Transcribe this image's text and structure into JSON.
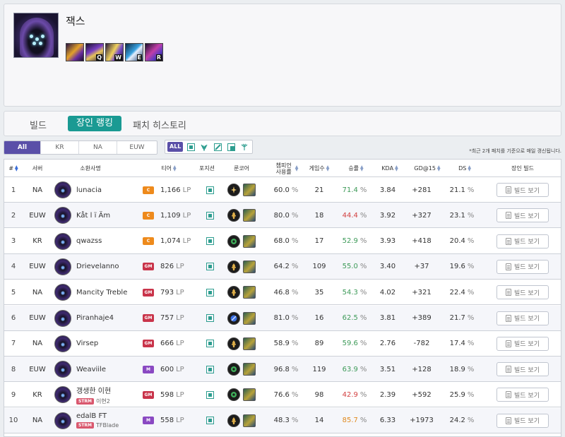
{
  "champion": {
    "name": "잭스",
    "skills": [
      {
        "key": "",
        "icon": "passive-icon"
      },
      {
        "key": "Q",
        "icon": "skill-q-icon"
      },
      {
        "key": "W",
        "icon": "skill-w-icon"
      },
      {
        "key": "E",
        "icon": "skill-e-icon"
      },
      {
        "key": "R",
        "icon": "skill-r-icon"
      }
    ]
  },
  "tabs": [
    {
      "label": "빌드",
      "active": false
    },
    {
      "label": "장인 랭킹",
      "active": true
    },
    {
      "label": "패치 히스토리",
      "active": false
    }
  ],
  "regions": [
    {
      "label": "All",
      "active": true
    },
    {
      "label": "KR",
      "active": false
    },
    {
      "label": "NA",
      "active": false
    },
    {
      "label": "EUW",
      "active": false
    }
  ],
  "positions": {
    "all_label": "ALL",
    "icons": [
      "top-lane-icon",
      "jungle-icon",
      "mid-lane-icon",
      "bottom-lane-icon",
      "support-icon"
    ]
  },
  "notice": "*최근 2개 패치를 기준으로 매일 갱신됩니다.",
  "columns": {
    "rank": "#",
    "server": "서버",
    "summoner": "소환사명",
    "tier": "티어",
    "position": "포지션",
    "rune": "룬코어",
    "pick_rate": "챔피언 사용률",
    "games": "게임수",
    "winrate": "승률",
    "kda": "KDA",
    "gd15": "GD@15",
    "ds": "DS",
    "build": "장인 빌드"
  },
  "lp_unit": "LP",
  "pct_unit": "%",
  "build_button_label": "빌드 보기",
  "colors": {
    "win_green": "#3d9a58",
    "win_red": "#d23f3f",
    "win_orange": "#e08a1e",
    "accent_teal": "#1a9a93",
    "accent_purple": "#5a4fa8"
  },
  "rows": [
    {
      "rank": "1",
      "server": "NA",
      "name": "lunacia",
      "sub": null,
      "tier": "C",
      "lp": "1,166",
      "rune": "electrocute-rune-icon",
      "pick": "60.0",
      "games": "21",
      "wr": "71.4",
      "wr_color": "green",
      "kda": "3.84",
      "gd": "+281",
      "ds": "21.1"
    },
    {
      "rank": "2",
      "server": "EUW",
      "name": "Kåt l ï Äm",
      "sub": null,
      "tier": "C",
      "lp": "1,109",
      "rune": "conqueror-rune-icon",
      "pick": "80.0",
      "games": "18",
      "wr": "44.4",
      "wr_color": "red",
      "kda": "3.92",
      "gd": "+327",
      "ds": "23.1"
    },
    {
      "rank": "3",
      "server": "KR",
      "name": "qwazss",
      "sub": null,
      "tier": "C",
      "lp": "1,074",
      "rune": "grasp-rune-icon",
      "pick": "68.0",
      "games": "17",
      "wr": "52.9",
      "wr_color": "green",
      "kda": "3.93",
      "gd": "+418",
      "ds": "20.4"
    },
    {
      "rank": "4",
      "server": "EUW",
      "name": "Drievelanno",
      "sub": null,
      "tier": "GM",
      "lp": "826",
      "rune": "conqueror-rune-icon",
      "pick": "64.2",
      "games": "109",
      "wr": "55.0",
      "wr_color": "green",
      "kda": "3.40",
      "gd": "+37",
      "ds": "19.6"
    },
    {
      "rank": "5",
      "server": "NA",
      "name": "Mancity Treble",
      "sub": null,
      "tier": "GM",
      "lp": "793",
      "rune": "conqueror-rune-icon",
      "pick": "46.8",
      "games": "35",
      "wr": "54.3",
      "wr_color": "green",
      "kda": "4.02",
      "gd": "+321",
      "ds": "22.4"
    },
    {
      "rank": "6",
      "server": "EUW",
      "name": "Piranhaje4",
      "sub": null,
      "tier": "GM",
      "lp": "757",
      "rune": "first-strike-rune-icon",
      "pick": "81.0",
      "games": "16",
      "wr": "62.5",
      "wr_color": "green",
      "kda": "3.81",
      "gd": "+389",
      "ds": "21.7"
    },
    {
      "rank": "7",
      "server": "NA",
      "name": "Virsep",
      "sub": null,
      "tier": "GM",
      "lp": "666",
      "rune": "conqueror-rune-icon",
      "pick": "58.9",
      "games": "89",
      "wr": "59.6",
      "wr_color": "green",
      "kda": "2.76",
      "gd": "-782",
      "ds": "17.4"
    },
    {
      "rank": "8",
      "server": "EUW",
      "name": "Weaviile",
      "sub": null,
      "tier": "M",
      "lp": "600",
      "rune": "grasp-rune-icon",
      "pick": "96.8",
      "games": "119",
      "wr": "63.9",
      "wr_color": "green",
      "kda": "3.51",
      "gd": "+128",
      "ds": "18.9"
    },
    {
      "rank": "9",
      "server": "KR",
      "name": "갱생한 이현",
      "sub": {
        "badge": "STRM",
        "team": "이현2"
      },
      "tier": "GM",
      "lp": "598",
      "rune": "grasp-rune-icon",
      "pick": "76.6",
      "games": "98",
      "wr": "42.9",
      "wr_color": "red",
      "kda": "2.39",
      "gd": "+592",
      "ds": "25.9"
    },
    {
      "rank": "10",
      "server": "NA",
      "name": "edalB FT",
      "sub": {
        "badge": "STRM",
        "team": "TFBlade"
      },
      "tier": "M",
      "lp": "558",
      "rune": "conqueror-rune-icon",
      "pick": "48.3",
      "games": "14",
      "wr": "85.7",
      "wr_color": "orange",
      "kda": "6.33",
      "gd": "+1973",
      "ds": "24.2"
    }
  ]
}
